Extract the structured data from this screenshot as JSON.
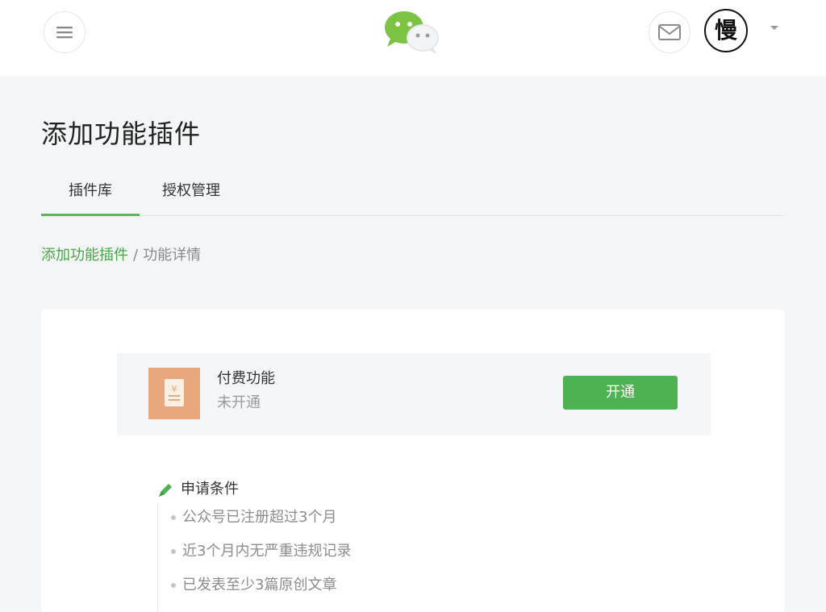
{
  "topbar": {
    "menu_icon": "hamburger-menu-icon",
    "logo_icon": "wechat-logo-icon",
    "mail_icon": "envelope-icon",
    "avatar_text": "慢",
    "avatar_caret_icon": "caret-down-icon"
  },
  "page": {
    "title": "添加功能插件"
  },
  "tabs": [
    {
      "label": "插件库",
      "active": true
    },
    {
      "label": "授权管理",
      "active": false
    }
  ],
  "breadcrumb": {
    "parent": "添加功能插件",
    "separator": "/",
    "current": "功能详情"
  },
  "feature": {
    "icon": "yuan-receipt-icon",
    "name": "付费功能",
    "status": "未开通",
    "button_label": "开通"
  },
  "conditions": {
    "icon": "pencil-icon",
    "title": "申请条件",
    "items": [
      "公众号已注册超过3个月",
      "近3个月内无严重违规记录",
      "已发表至少3篇原创文章"
    ]
  },
  "colors": {
    "accent_green": "#4fb252",
    "link_green": "#4aa546",
    "background": "#f3f5f6",
    "feature_icon_bg": "#e8a77c"
  }
}
